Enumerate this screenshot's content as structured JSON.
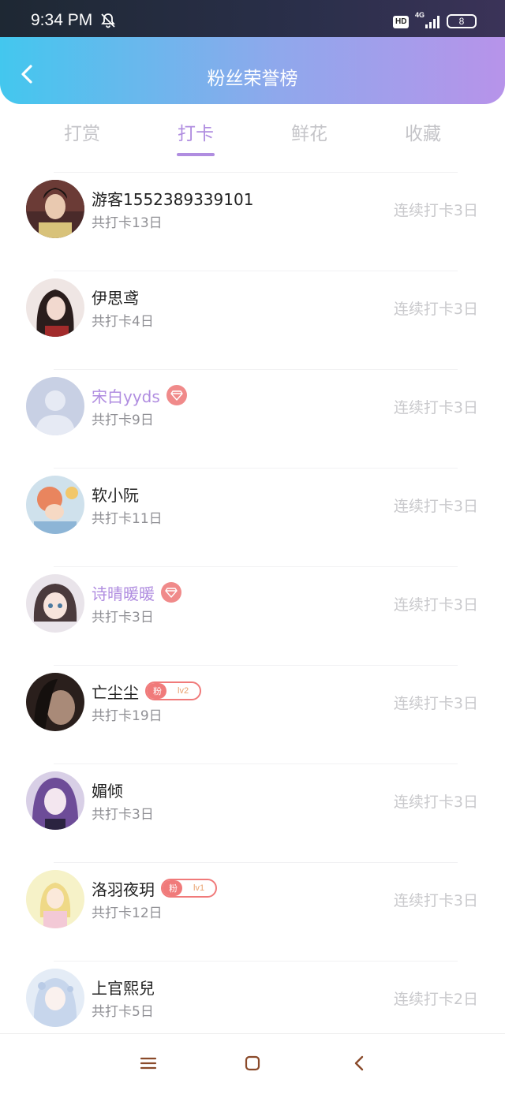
{
  "status_bar": {
    "time": "9:34 PM",
    "hd_label": "HD",
    "network_label": "4G",
    "battery_level": "8"
  },
  "header": {
    "title": "粉丝荣誉榜",
    "back_icon": "chevron-left-icon"
  },
  "tabs": [
    {
      "label": "打赏",
      "active": false
    },
    {
      "label": "打卡",
      "active": true
    },
    {
      "label": "鲜花",
      "active": false
    },
    {
      "label": "收藏",
      "active": false
    }
  ],
  "colors": {
    "accent": "#b08de0",
    "header_gradient_start": "#43c7ee",
    "header_gradient_end": "#b793ea",
    "badge_red": "#f07a7a"
  },
  "fans": [
    {
      "name": "游客1552389339101",
      "total": "共打卡13日",
      "streak": "连续打卡3日",
      "vip": false,
      "badge": null
    },
    {
      "name": "伊思鸢",
      "total": "共打卡4日",
      "streak": "连续打卡3日",
      "vip": false,
      "badge": null
    },
    {
      "name": "宋白yyds",
      "total": "共打卡9日",
      "streak": "连续打卡3日",
      "vip": true,
      "badge": null
    },
    {
      "name": "软小阮",
      "total": "共打卡11日",
      "streak": "连续打卡3日",
      "vip": false,
      "badge": null
    },
    {
      "name": "诗晴暖暖",
      "total": "共打卡3日",
      "streak": "连续打卡3日",
      "vip": true,
      "badge": null
    },
    {
      "name": "亡尘尘",
      "total": "共打卡19日",
      "streak": "连续打卡3日",
      "vip": false,
      "badge": {
        "tag": "粉",
        "level": "lv2"
      }
    },
    {
      "name": "媚倾",
      "total": "共打卡3日",
      "streak": "连续打卡3日",
      "vip": false,
      "badge": null
    },
    {
      "name": "洛羽夜玥",
      "total": "共打卡12日",
      "streak": "连续打卡3日",
      "vip": false,
      "badge": {
        "tag": "粉",
        "level": "lv1"
      }
    },
    {
      "name": "上官熙兒",
      "total": "共打卡5日",
      "streak": "连续打卡2日",
      "vip": false,
      "badge": null
    }
  ],
  "nav_bar": {
    "menu_icon": "menu-icon",
    "home_icon": "home-square-icon",
    "back_icon": "back-chevron-icon"
  }
}
